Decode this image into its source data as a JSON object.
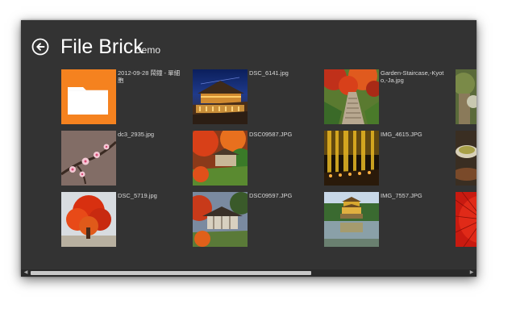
{
  "header": {
    "back_icon": "back-arrow-circle-icon",
    "title": "File Brick",
    "subtitle": "Demo"
  },
  "items": [
    {
      "label": "2012-09-28 鬧鐘 - 單細胞",
      "kind": "folder",
      "icon": "folder-icon"
    },
    {
      "label": "DSC_6141.jpg",
      "kind": "image",
      "icon": "temple-night-photo"
    },
    {
      "label": "Garden-Staircase,-Kyoto,-Ja.jpg",
      "kind": "image",
      "icon": "garden-staircase-photo"
    },
    {
      "label": "dc3_2935.jpg",
      "kind": "image",
      "icon": "plum-blossom-photo"
    },
    {
      "label": "DSC09587.JPG",
      "kind": "image",
      "icon": "autumn-temple-photo"
    },
    {
      "label": "IMG_4615.JPG",
      "kind": "image",
      "icon": "bamboo-forest-photo"
    },
    {
      "label": "DSC_5719.jpg",
      "kind": "image",
      "icon": "red-maple-tree-photo"
    },
    {
      "label": "DSC09597.JPG",
      "kind": "image",
      "icon": "temple-roof-photo"
    },
    {
      "label": "IMG_7557.JPG",
      "kind": "image",
      "icon": "golden-pavilion-photo"
    }
  ],
  "partial_items": [
    {
      "icon": "partial-tree-photo"
    },
    {
      "icon": "partial-teacup-photo"
    },
    {
      "icon": "partial-red-umbrella-photo"
    }
  ],
  "colors": {
    "background": "#333333",
    "folder_accent": "#f5821f",
    "text": "#ffffff"
  },
  "scrollbar": {
    "left_arrow": "◀",
    "right_arrow": "▶"
  }
}
